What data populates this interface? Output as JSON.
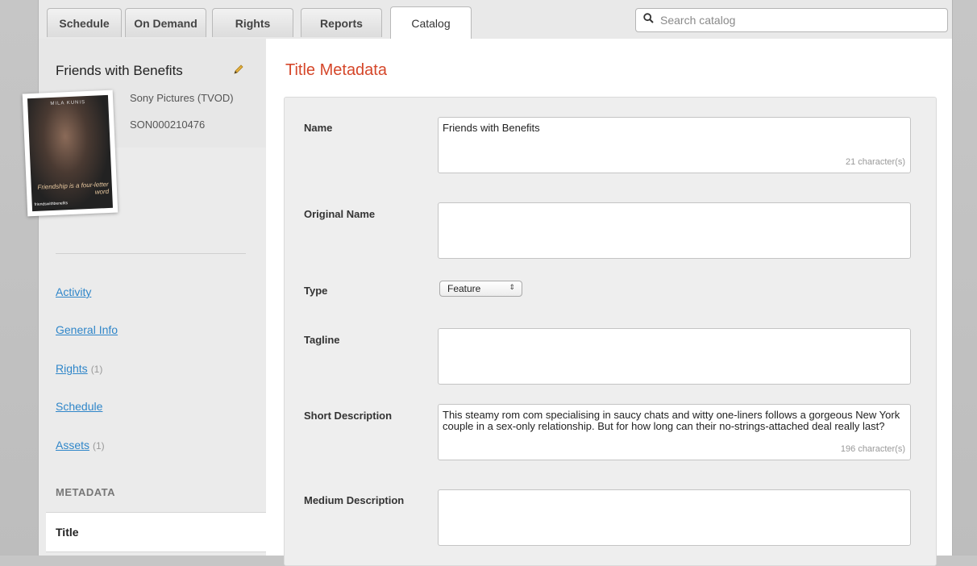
{
  "tabs": [
    {
      "label": "Schedule"
    },
    {
      "label": "On Demand"
    },
    {
      "label": "Rights"
    },
    {
      "label": "Reports"
    },
    {
      "label": "Catalog",
      "active": true
    }
  ],
  "search": {
    "placeholder": "Search catalog"
  },
  "sidebar": {
    "title": "Friends with Benefits",
    "studio": "Sony Pictures (TVOD)",
    "code": "SON000210476",
    "poster": {
      "headline": "MILA KUNIS",
      "tagline": "Friendship is a four-letter word",
      "logo": "friendswithbenefits"
    },
    "nav": [
      {
        "label": "Activity",
        "count": ""
      },
      {
        "label": "General Info",
        "count": ""
      },
      {
        "label": "Rights",
        "count": "(1)"
      },
      {
        "label": "Schedule",
        "count": ""
      },
      {
        "label": "Assets",
        "count": "(1)"
      }
    ],
    "section_label": "METADATA",
    "selected_item": "Title"
  },
  "main": {
    "title": "Title Metadata",
    "fields": {
      "name": {
        "label": "Name",
        "value": "Friends with Benefits",
        "count": "21 character(s)"
      },
      "original_name": {
        "label": "Original Name",
        "value": ""
      },
      "type": {
        "label": "Type",
        "value": "Feature"
      },
      "tagline": {
        "label": "Tagline",
        "value": ""
      },
      "short_description": {
        "label": "Short Description",
        "value": "This steamy rom com specialising in saucy chats and witty one-liners follows a gorgeous New York couple in a sex-only relationship. But for how long can their no-strings-attached deal really last?",
        "count": "196 character(s)"
      },
      "medium_description": {
        "label": "Medium Description",
        "value": ""
      }
    }
  },
  "colors": {
    "accent": "#d5472a",
    "link": "#2f86c9"
  }
}
